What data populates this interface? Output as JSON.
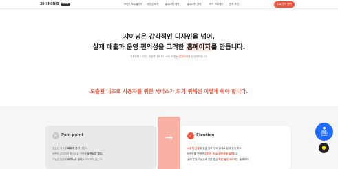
{
  "header": {
    "logo": "SHINING Inc.",
    "logo_tag": "COMPANY",
    "nav": [
      "브랜드 포트폴리오",
      "샤이닝 소개",
      "홈페이지 제작",
      "홈페이지 관리",
      "제작 프로세스",
      "문의 하기"
    ],
    "cta": "무료 견적 문의"
  },
  "hero": {
    "line1": "샤이닝은 감각적인 디자인을 넘어,",
    "line2_before": "실제 매출과 운영 편의성을 고려한 ",
    "line2_highlight": "홈페이지",
    "line2_after": "를 만듭니다.",
    "sub_before": "기획부터 디자인, 개발까지 비즈니스에 꼭 맞는 ",
    "sub_accent": "홈페이지",
    "sub_after": "를 완성해드립니다."
  },
  "section": {
    "title": "도출된 니즈로 사용자를 위한 서비스가 되기 위해선 이렇게 해야 합니다."
  },
  "pain": {
    "title": "Pain point",
    "line1_before": "정돈된 정보를 ",
    "line1_bold": "빠르게 찾기",
    "line1_after": " 어렵다.",
    "line2_before": "브랜드 이미지가 웹사이트 전반에 ",
    "line2_bold": "일관되지 않다.",
    "line3_before": "기능은 많은데 ",
    "line3_bold": "비즈니스 성과",
    "line3_after": "로 이어지지 않는다."
  },
  "solution": {
    "title": "Sloution",
    "line1_red": "사용자 흐름",
    "line1_after": "에 맞춘 정보 구조 설계로 쉽게 찾게 하고",
    "line2_before": "브랜드를 반영한 ",
    "line2_red": "디자인 톤 & 일관성을 유지",
    "line2_after": "하고",
    "line3_before": "실제 운영 가능성과 전환 중심 ",
    "line3_red": "목표 달성 유도",
    "line3_after": "하는 홈페이지"
  },
  "floating": {
    "chat_label_1": "CHAT",
    "chat_label_2": "문의하기",
    "chat_label_3": "CLICK",
    "chat_icon": "chat-icon",
    "kakao_icon": "kakao-talk-icon"
  },
  "colors": {
    "accent": "#f0543b",
    "highlight_bg": "#fde2dd",
    "arrow_box": "#f7b0a3",
    "chat_blue": "#1f6bff"
  }
}
